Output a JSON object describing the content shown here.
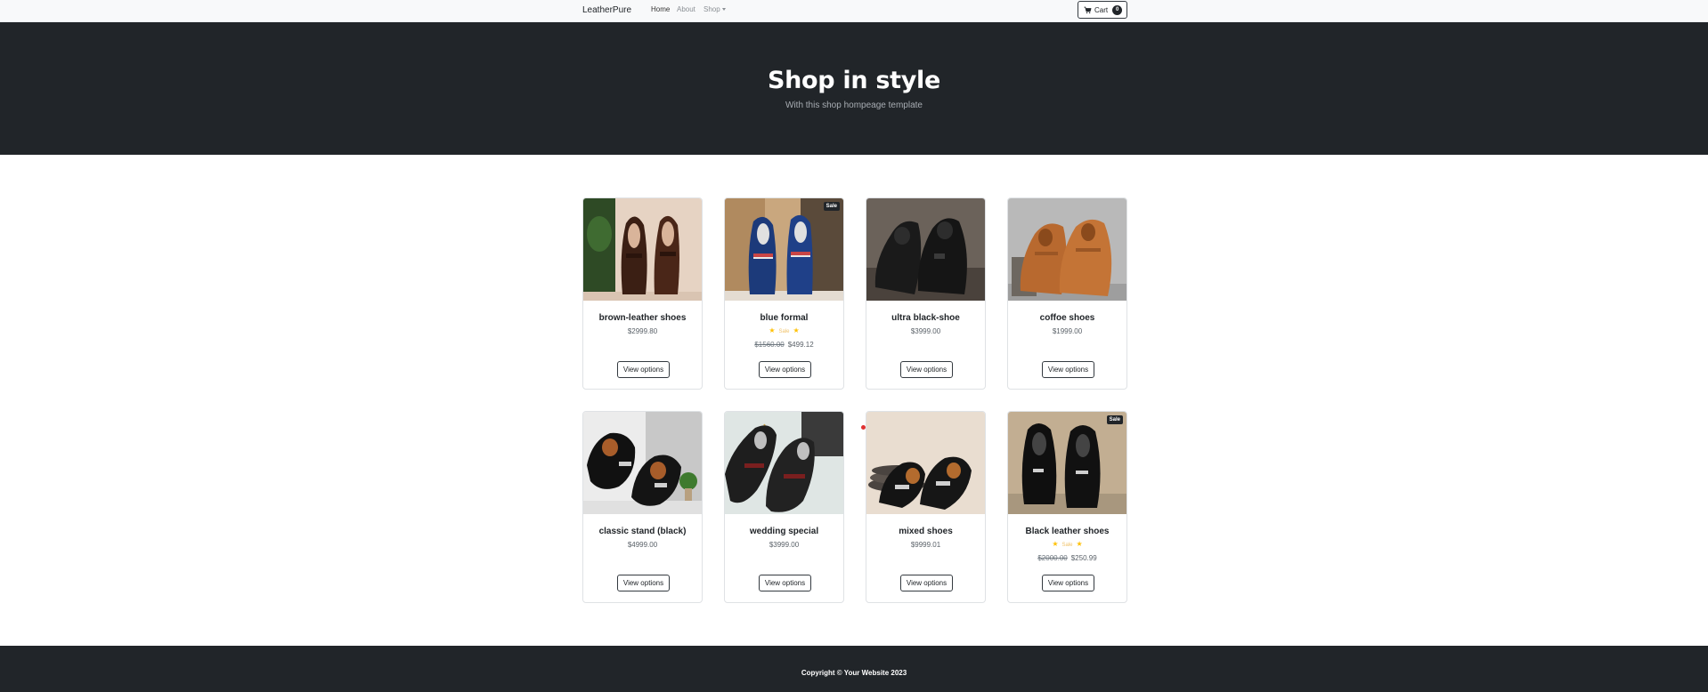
{
  "navbar": {
    "brand": "LeatherPure",
    "links": [
      "Home",
      "About",
      "Shop"
    ],
    "cart_label": "Cart",
    "cart_count": "0"
  },
  "hero": {
    "title": "Shop in style",
    "subtitle": "With this shop hompeage template"
  },
  "products": [
    {
      "name": "brown-leather shoes",
      "price": "$2999.80",
      "button": "View options"
    },
    {
      "name": "blue formal",
      "badge": "Sale",
      "stars_label": "Sale",
      "old_price": "$1560.00",
      "price": "$499.12",
      "button": "View options"
    },
    {
      "name": "ultra black-shoe",
      "price": "$3999.00",
      "button": "View options"
    },
    {
      "name": "coffoe shoes",
      "price": "$1999.00",
      "button": "View options"
    },
    {
      "name": "classic stand (black)",
      "price": "$4999.00",
      "button": "View options"
    },
    {
      "name": "wedding special",
      "price": "$3999.00",
      "button": "View options"
    },
    {
      "name": "mixed shoes",
      "price": "$9999.01",
      "button": "View options"
    },
    {
      "name": "Black leather shoes",
      "badge": "Sale",
      "stars_label": "Sale",
      "old_price": "$2000.00",
      "price": "$250.99",
      "button": "View options"
    }
  ],
  "footer": {
    "copyright": "Copyright © Your Website 2023"
  },
  "colors": {
    "dark": "#212529",
    "light": "#f8f9fa",
    "star": "#ffc107"
  }
}
